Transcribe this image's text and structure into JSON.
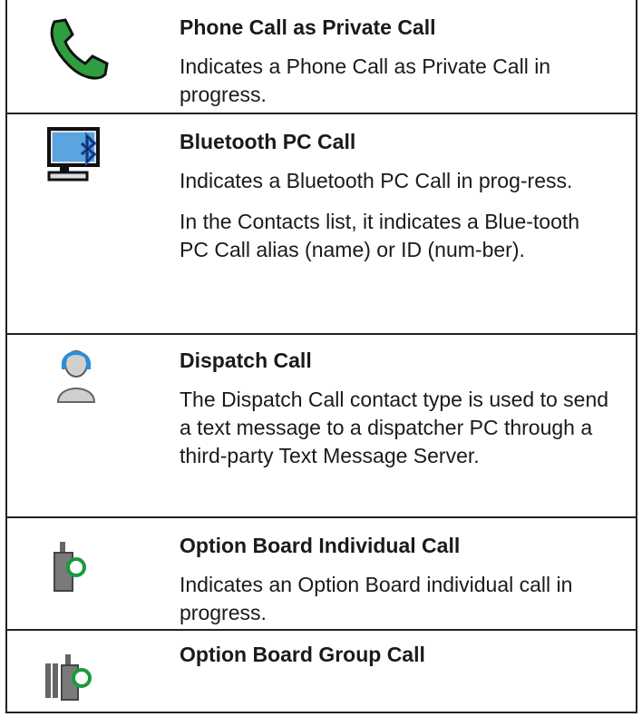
{
  "rows": [
    {
      "icon": "phone-icon",
      "title": "Phone Call as Private Call",
      "paragraphs": [
        "Indicates a Phone Call as Private Call in progress."
      ]
    },
    {
      "icon": "bluetooth-pc-icon",
      "title": "Bluetooth PC Call",
      "paragraphs": [
        "Indicates a Bluetooth PC Call in prog-ress.",
        "In the Contacts list, it indicates a Blue-tooth PC Call alias (name) or ID (num-ber)."
      ]
    },
    {
      "icon": "dispatcher-icon",
      "title": "Dispatch Call",
      "paragraphs": [
        "The Dispatch Call contact type is used to send a text message to a dispatcher PC through a third-party Text Message Server."
      ]
    },
    {
      "icon": "option-board-individual-icon",
      "title": "Option Board Individual Call",
      "paragraphs": [
        "Indicates an Option Board individual call in progress."
      ]
    },
    {
      "icon": "option-board-group-icon",
      "title": "Option Board Group Call",
      "paragraphs": []
    }
  ],
  "colors": {
    "phone_green": "#2e9e3e",
    "bluetooth_blue": "#1f5fc9",
    "dispatch_blue": "#2d8fd6",
    "option_green": "#1a9a3a",
    "device_gray": "#7a7a7a"
  }
}
